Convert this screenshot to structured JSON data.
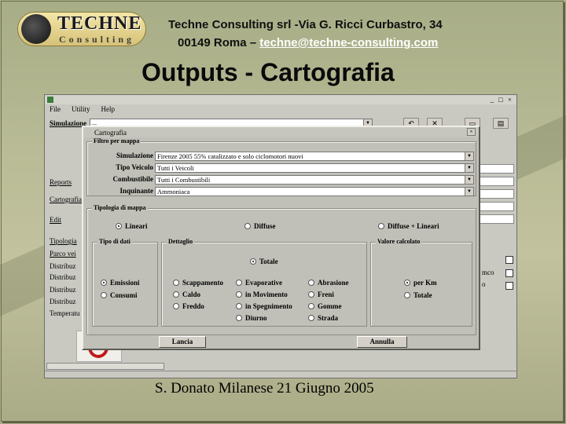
{
  "header": {
    "logo": {
      "word": "TECHNE",
      "sub": "Consulting"
    },
    "company_line": "Techne Consulting srl -Via G. Ricci Curbastro, 34",
    "address_prefix": "00149 Roma – ",
    "email": "techne@techne-consulting.com"
  },
  "slide_title": "Outputs - Cartografia",
  "footer": "S. Donato Milanese  21 Giugno 2005",
  "app_window": {
    "menu": [
      "File",
      "Utility",
      "Help"
    ],
    "window_buttons": "_ □ ×",
    "simulazione_label": "Simulazione",
    "simulazione_value": "...",
    "left_items": [
      "Reports",
      "Cartografia",
      "Edit",
      "Tipologia",
      "Parco vei",
      "Distribuz",
      "Distribuz",
      "Distribuz",
      "Distribuz",
      "Temperatu"
    ],
    "right_labels": [
      "mco",
      "o"
    ]
  },
  "dialog": {
    "title": "Cartografia",
    "filter_group": "Filtro per mappa",
    "fields": [
      {
        "label": "Simulazione",
        "value": "Firenze 2005 55% catalizzato e solo ciclomotori nuovi"
      },
      {
        "label": "Tipo Veicolo",
        "value": "Tutti i Veicoli"
      },
      {
        "label": "Combustibile",
        "value": "Tutti i Combustibili"
      },
      {
        "label": "Inquinante",
        "value": "Ammoniaca"
      }
    ],
    "map_type_group": "Tipologia di mappa",
    "map_types": [
      {
        "label": "Lineari",
        "selected": true
      },
      {
        "label": "Diffuse",
        "selected": false
      },
      {
        "label": "Diffuse + Lineari",
        "selected": false
      }
    ],
    "data_type_group": "Tipo di dati",
    "data_types": [
      {
        "label": "Emissioni",
        "selected": true
      },
      {
        "label": "Consumi",
        "selected": false
      }
    ],
    "detail_group": "Dettaglio",
    "detail_total": {
      "label": "Totale",
      "selected": true
    },
    "detail_options": [
      [
        "Scappamento",
        "Evaporative",
        "Abrasione"
      ],
      [
        "Caldo",
        "in Movimento",
        "Freni"
      ],
      [
        "Freddo",
        "in Spegnimento",
        "Gomme"
      ],
      [
        null,
        "Diurno",
        "Strada"
      ]
    ],
    "value_group": "Valore calcolato",
    "value_options": [
      {
        "label": "per Km",
        "selected": true
      },
      {
        "label": "Totale",
        "selected": false
      }
    ],
    "buttons": {
      "run": "Lancia",
      "cancel": "Annulla"
    }
  },
  "colors": {
    "background": "#b8bb95",
    "email_link": "#ffffff",
    "window_face": "#c0c0b8"
  }
}
